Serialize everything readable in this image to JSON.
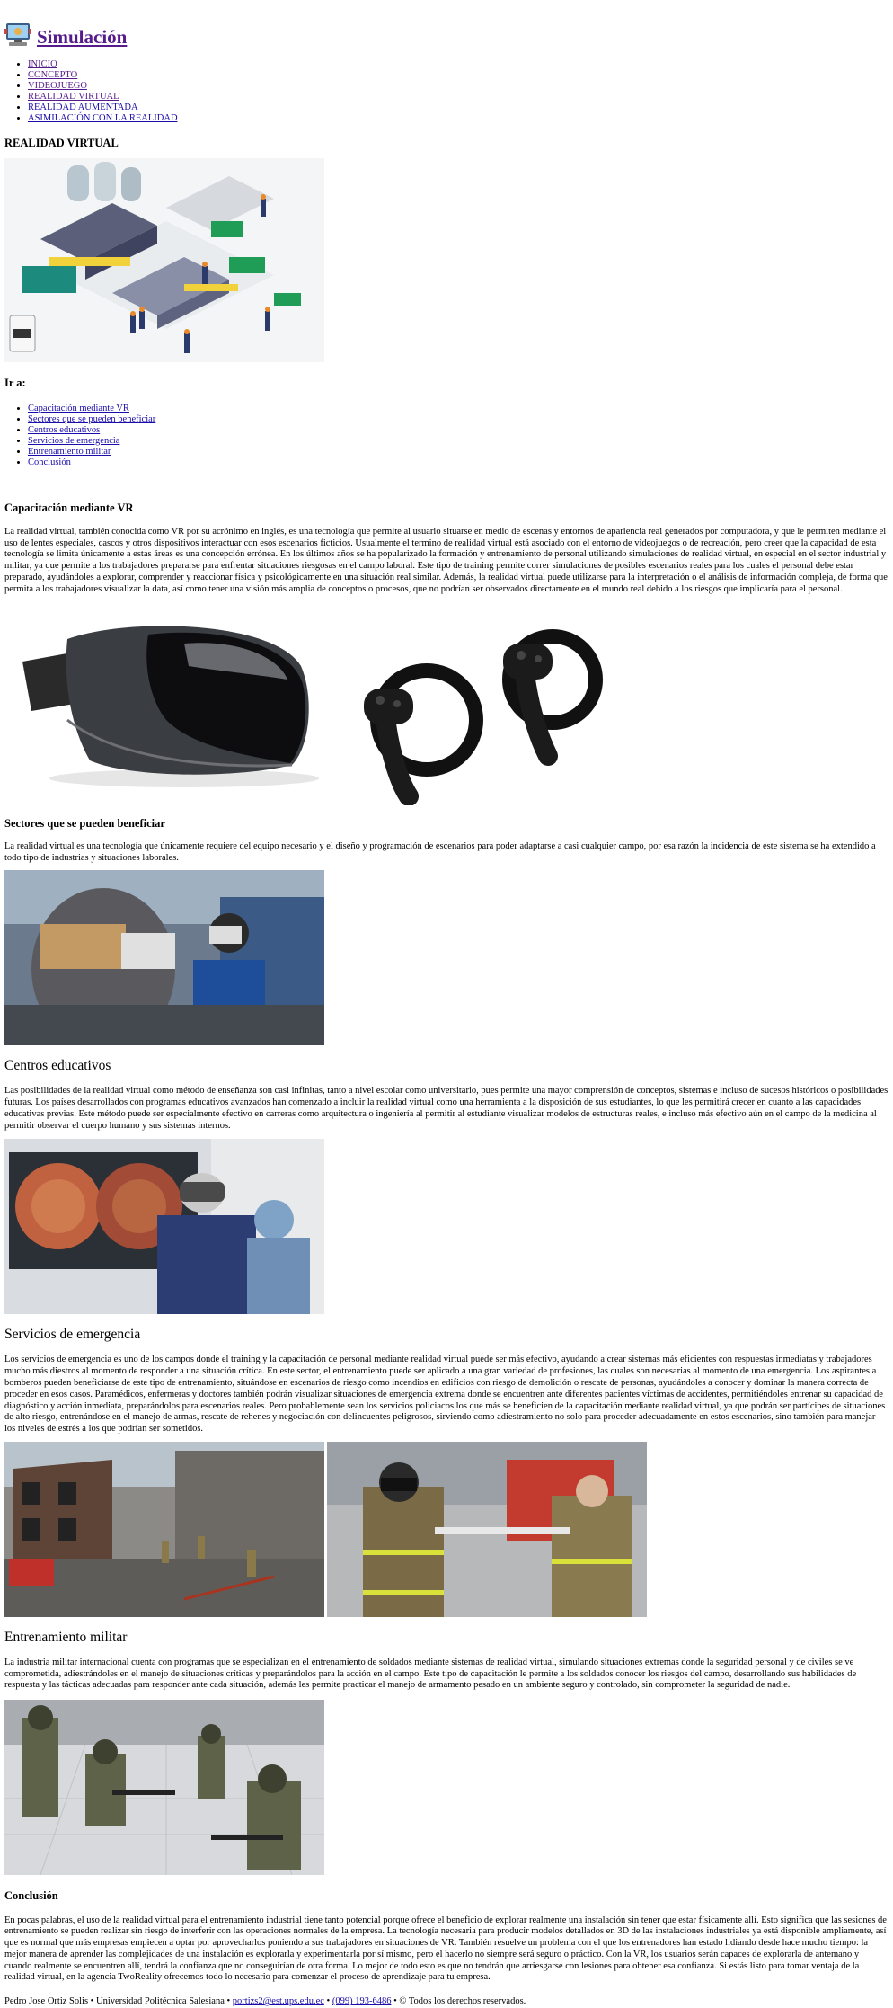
{
  "site": {
    "title": "Simulación"
  },
  "nav": {
    "items": [
      {
        "label": "INICIO"
      },
      {
        "label": "CONCEPTO"
      },
      {
        "label": "VIDEOJUEGO"
      },
      {
        "label": "REALIDAD VIRTUAL"
      },
      {
        "label": "REALIDAD AUMENTADA"
      },
      {
        "label": "ASIMILACIÓN CON LA REALIDAD"
      }
    ]
  },
  "page": {
    "heading": "REALIDAD VIRTUAL"
  },
  "toc": {
    "heading": "Ir a:",
    "items": [
      {
        "label": "Capacitación mediante VR"
      },
      {
        "label": "Sectores que se pueden beneficiar"
      },
      {
        "label": "Centros educativos"
      },
      {
        "label": "Servicios de emergencia"
      },
      {
        "label": "Entrenamiento militar"
      },
      {
        "label": "Conclusión"
      }
    ]
  },
  "sections": {
    "capacitacion": {
      "title": "Capacitación mediante VR",
      "text": "La realidad virtual, también conocida como VR por su acrónimo en inglés, es una tecnología que permite al usuario situarse en medio de escenas y entornos de apariencia real generados por computadora, y que le permiten mediante el uso de lentes especiales, cascos y otros dispositivos interactuar con esos escenarios ficticios. Usualmente el termino de realidad virtual está asociado con el entorno de videojuegos o de recreación, pero creer que la capacidad de esta tecnología se limita únicamente a estas áreas es una concepción errónea. En los últimos años se ha popularizado la formación y entrenamiento de personal utilizando simulaciones de realidad virtual, en especial en el sector industrial y militar, ya que permite a los trabajadores prepararse para enfrentar situaciones riesgosas en el campo laboral. Este tipo de training permite correr simulaciones de posibles escenarios reales para los cuales el personal debe estar preparado, ayudándoles a explorar, comprender y reaccionar física y psicológicamente en una situación real similar. Además, la realidad virtual puede utilizarse para la interpretación o el análisis de información compleja, de forma que permita a los trabajadores visualizar la data, así como tener una visión más amplia de conceptos o procesos, que no podrían ser observados directamente en el mundo real debido a los riesgos que implicaría para el personal."
    },
    "sectores": {
      "title": "Sectores que se pueden beneficiar",
      "text": "La realidad virtual es una tecnología que únicamente requiere del equipo necesario y el diseño y programación de escenarios para poder adaptarse a casi cualquier campo, por esa razón la incidencia de este sistema se ha extendido a todo tipo de industrias y situaciones laborales."
    },
    "educativos": {
      "title": "Centros educativos",
      "text": "Las posibilidades de la realidad virtual como método de enseñanza son casi infinitas, tanto a nivel escolar como universitario, pues permite una mayor comprensión de conceptos, sistemas e incluso de sucesos históricos o posibilidades futuras. Los países desarrollados con programas educativos avanzados han comenzado a incluir la realidad virtual como una herramienta a la disposición de sus estudiantes, lo que les permitirá crecer en cuanto a las capacidades educativas previas. Este método puede ser especialmente efectivo en carreras como arquitectura o ingeniería al permitir al estudiante visualizar modelos de estructuras reales, e incluso más efectivo aún en el campo de la medicina al permitir observar el cuerpo humano y sus sistemas internos."
    },
    "emergencia": {
      "title": "Servicios de emergencia",
      "text": "Los servicios de emergencia es uno de los campos donde el training y la capacitación de personal mediante realidad virtual puede ser más efectivo, ayudando a crear sistemas más eficientes con respuestas inmediatas y trabajadores mucho más diestros al momento de responder a una situación crítica. En este sector, el entrenamiento puede ser aplicado a una gran variedad de profesiones, las cuales son necesarias al momento de una emergencia. Los aspirantes a bomberos pueden beneficiarse de este tipo de entrenamiento, situándose en escenarios de riesgo como incendios en edificios con riesgo de demolición o rescate de personas, ayudándoles a conocer y dominar la manera correcta de proceder en esos casos. Paramédicos, enfermeras y doctores también podrán visualizar situaciones de emergencia extrema donde se encuentren ante diferentes pacientes víctimas de accidentes, permitiéndoles entrenar su capacidad de diagnóstico y acción inmediata, preparándolos para escenarios reales. Pero probablemente sean los servicios policiacos los que más se beneficien de la capacitación mediante realidad virtual, ya que podrán ser partícipes de situaciones de alto riesgo, entrenándose en el manejo de armas, rescate de rehenes y negociación con delincuentes peligrosos, sirviendo como adiestramiento no solo para proceder adecuadamente en estos escenarios, sino también para manejar los niveles de estrés a los que podrían ser sometidos."
    },
    "militar": {
      "title": "Entrenamiento militar",
      "text": "La industria militar internacional cuenta con programas que se especializan en el entrenamiento de soldados mediante sistemas de realidad virtual, simulando situaciones extremas donde la seguridad personal y de civiles se ve comprometida, adiestrándoles en el manejo de situaciones críticas y preparándolos para la acción en el campo. Este tipo de capacitación le permite a los soldados conocer los riesgos del campo, desarrollando sus habilidades de respuesta y las tácticas adecuadas para responder ante cada situación, además les permite practicar el manejo de armamento pesado en un ambiente seguro y controlado, sin comprometer la seguridad de nadie."
    },
    "conclusion": {
      "title": "Conclusión",
      "text": "En pocas palabras, el uso de la realidad virtual para el entrenamiento industrial tiene tanto potencial porque ofrece el beneficio de explorar realmente una instalación sin tener que estar físicamente allí. Esto significa que las sesiones de entrenamiento se pueden realizar sin riesgo de interferir con las operaciones normales de la empresa. La tecnología necesaria para producir modelos detallados en 3D de las instalaciones industriales ya está disponible ampliamente, así que es normal que más empresas empiecen a optar por aprovecharlos poniendo a sus trabajadores en situaciones de VR. También resuelve un problema con el que los entrenadores han estado lidiando desde hace mucho tiempo: la mejor manera de aprender las complejidades de una instalación es explorarla y experimentarla por sí mismo, pero el hacerlo no siempre será seguro o práctico. Con la VR, los usuarios serán capaces de explorarla de antemano y cuando realmente se encuentren allí, tendrá la confianza que no conseguirían de otra forma. Lo mejor de todo esto es que no tendrán que arriesgarse con lesiones para obtener esa confianza. Si estás listo para tomar ventaja de la realidad virtual, en la agencia TwoReality ofrecemos todo lo necesario para comenzar el proceso de aprendizaje para tu empresa."
    }
  },
  "footer": {
    "author": "Pedro Jose Ortiz Solis",
    "sep1": " • ",
    "university": "Universidad Politécnica Salesiana",
    "sep2": " • ",
    "email": "portizs2@est.ups.edu.ec",
    "sep3": " • ",
    "phone": "(099) 193-6486",
    "sep4": " • ",
    "rights": "© Todos los derechos reservados."
  },
  "colors": {
    "link": "#1a0dab",
    "visited": "#551a8b",
    "text": "#000000"
  }
}
